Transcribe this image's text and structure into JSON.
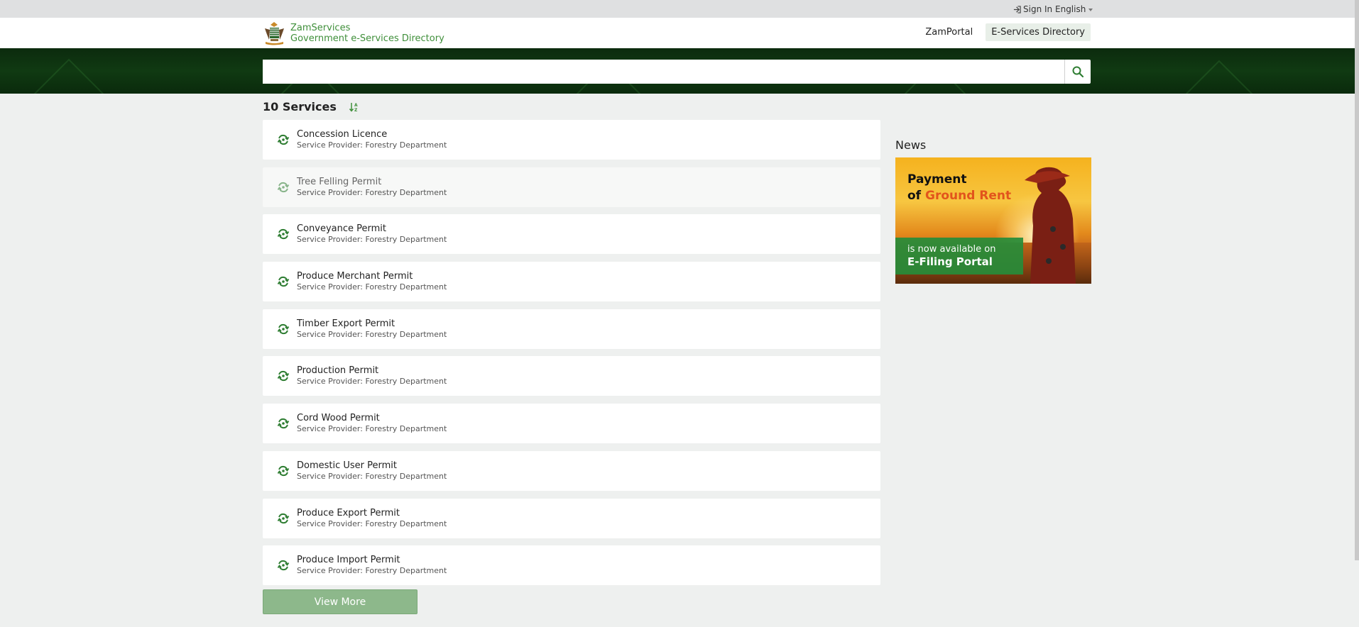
{
  "topbar": {
    "sign_in": "Sign In",
    "language": "English"
  },
  "brand": {
    "line1": "ZamServices",
    "line2": "Government e-Services Directory"
  },
  "nav": {
    "zamportal": "ZamPortal",
    "directory": "E-Services Directory"
  },
  "search": {
    "placeholder": "",
    "value": ""
  },
  "results": {
    "count_label": "10 Services"
  },
  "services": [
    {
      "title": "Concession Licence",
      "provider": "Service Provider: Forestry Department"
    },
    {
      "title": "Tree Felling Permit",
      "provider": "Service Provider: Forestry Department"
    },
    {
      "title": "Conveyance Permit",
      "provider": "Service Provider: Forestry Department"
    },
    {
      "title": "Produce Merchant Permit",
      "provider": "Service Provider: Forestry Department"
    },
    {
      "title": "Timber Export Permit",
      "provider": "Service Provider: Forestry Department"
    },
    {
      "title": "Production Permit",
      "provider": "Service Provider: Forestry Department"
    },
    {
      "title": "Cord Wood Permit",
      "provider": "Service Provider: Forestry Department"
    },
    {
      "title": "Domestic User Permit",
      "provider": "Service Provider: Forestry Department"
    },
    {
      "title": "Produce Export Permit",
      "provider": "Service Provider: Forestry Department"
    },
    {
      "title": "Produce Import Permit",
      "provider": "Service Provider: Forestry Department"
    }
  ],
  "view_more": "View More",
  "news": {
    "title": "News",
    "banner": {
      "line1": "Payment",
      "line2_prefix": "of ",
      "line2_highlight": "Ground Rent",
      "line3": "is now available on",
      "line4": "E-Filing Portal"
    }
  },
  "colors": {
    "brand_green": "#3f8f3a",
    "band": "#103a12",
    "view_more_bg": "#8db88b",
    "accent_orange": "#e2541c"
  }
}
